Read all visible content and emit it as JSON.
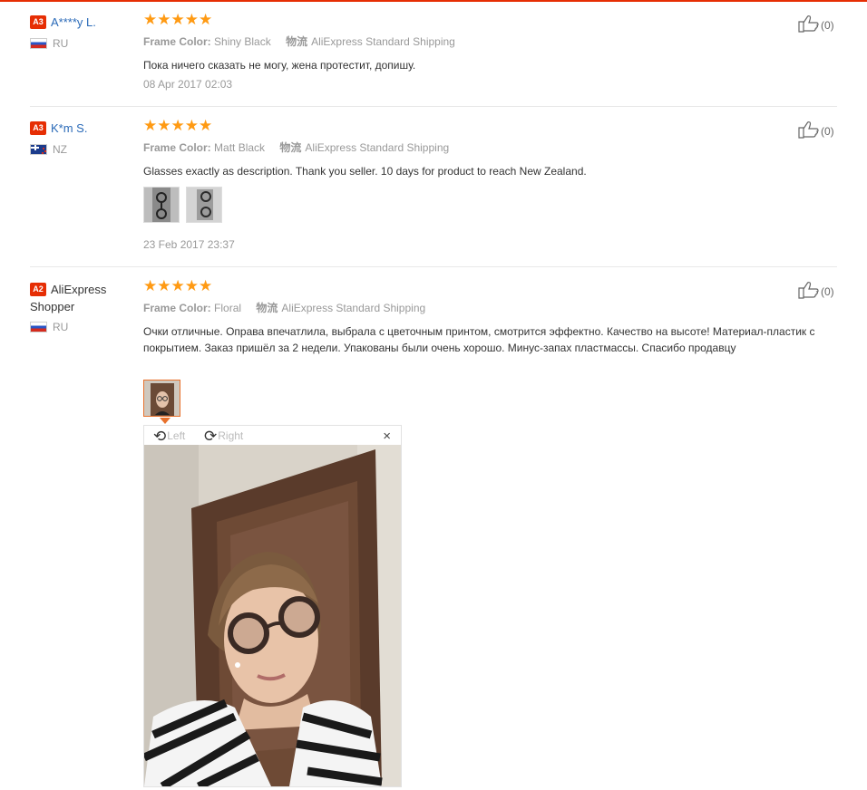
{
  "reviews": [
    {
      "badge": "A3",
      "name": "A****y L.",
      "country": "RU",
      "frame_label": "Frame Color:",
      "frame_value": "Shiny Black",
      "shipping_label": "物流",
      "shipping_value": "AliExpress Standard Shipping",
      "text": "Пока ничего сказать не могу, жена протестит, допишу.",
      "date": "08 Apr 2017 02:03",
      "likes": "(0)"
    },
    {
      "badge": "A3",
      "name": "K*m S.",
      "country": "NZ",
      "frame_label": "Frame Color:",
      "frame_value": "Matt Black",
      "shipping_label": "物流",
      "shipping_value": "AliExpress Standard Shipping",
      "text": "Glasses exactly as description. Thank you seller. 10 days for product to reach New Zealand.",
      "date": "23 Feb 2017 23:37",
      "likes": "(0)"
    },
    {
      "badge": "A2",
      "name": "AliExpress Shopper",
      "country": "RU",
      "frame_label": "Frame Color:",
      "frame_value": "Floral",
      "shipping_label": "物流",
      "shipping_value": "AliExpress Standard Shipping",
      "text": "Очки отличные. Оправа впечатлила, выбрала с цветочным принтом, смотрится эффектно. Качество на высоте! Материал-пластик с покрытием. Заказ пришёл за 2 недели. Упакованы были очень хорошо. Минус-запах пластмассы. Спасибо продавцу",
      "likes": "(0)"
    }
  ],
  "rating_stars": "★★★★★",
  "viewer": {
    "rotate_left": "Left",
    "rotate_right": "Right",
    "close": "×"
  },
  "colors": {
    "accent": "#e62e04",
    "star": "#ff9a13",
    "username": "#2a6ab8"
  }
}
